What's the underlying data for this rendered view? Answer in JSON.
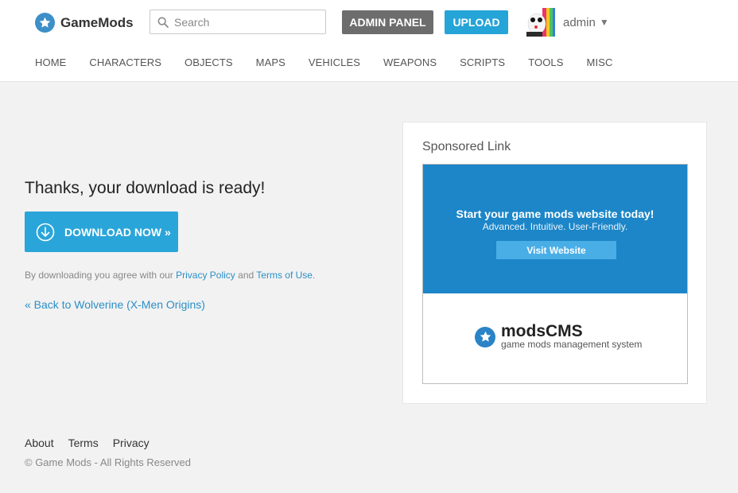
{
  "header": {
    "brand": "GameMods",
    "search_placeholder": "Search",
    "admin_label": "ADMIN PANEL",
    "upload_label": "UPLOAD",
    "user": {
      "name": "admin",
      "caret": "▼"
    }
  },
  "nav": {
    "items": [
      "HOME",
      "CHARACTERS",
      "OBJECTS",
      "MAPS",
      "VEHICLES",
      "WEAPONS",
      "SCRIPTS",
      "TOOLS",
      "MISC"
    ]
  },
  "main": {
    "title": "Thanks, your download is ready!",
    "download_label": "DOWNLOAD NOW »",
    "agree_prefix": "By downloading you agree with our ",
    "privacy_policy": "Privacy Policy",
    "agree_and": " and ",
    "terms_of_use": "Terms of Use",
    "agree_suffix": ".",
    "back_link": "« Back to Wolverine (X-Men Origins)"
  },
  "sponsor": {
    "title": "Sponsored Link",
    "ad_headline": "Start your game mods website today!",
    "ad_sub": "Advanced. Intuitive. User-Friendly.",
    "ad_button": "Visit Website",
    "ad_brand": "modsCMS",
    "ad_tagline": "game mods management system"
  },
  "footer": {
    "links": [
      "About",
      "Terms",
      "Privacy"
    ],
    "copyright": "© Game Mods - All Rights Reserved"
  },
  "colors": {
    "accent": "#25a4d8",
    "admin_button": "#6d6d6d",
    "ad_background": "#1c86c8",
    "link": "#2a8fc7"
  },
  "icons": {
    "logo": "star-icon",
    "search": "search-icon",
    "download": "download-arrow-icon",
    "user_caret": "caret-down-icon"
  }
}
